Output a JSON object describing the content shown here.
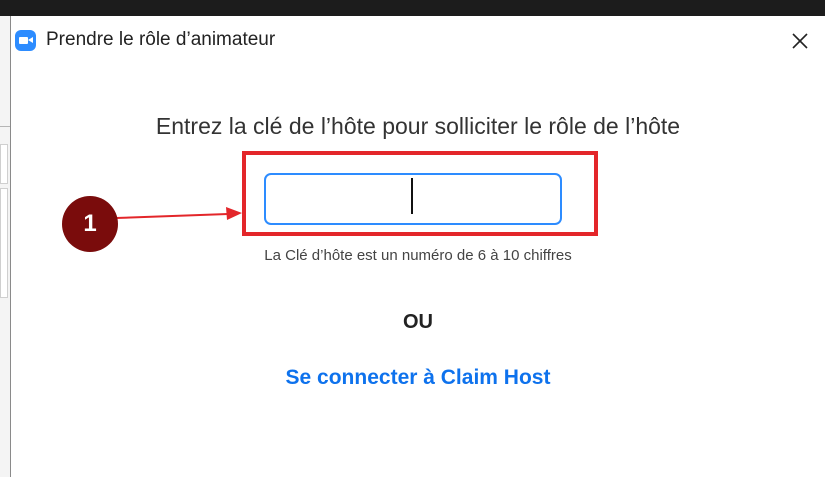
{
  "dialog": {
    "title": "Prendre le rôle d’animateur",
    "close_label": "✕"
  },
  "main": {
    "prompt": "Entrez la clé de l’hôte pour solliciter le rôle de l’hôte",
    "host_key_value": "",
    "hint": "La Clé d’hôte est un numéro de 6 à 10 chiffres",
    "or_label": "OU",
    "claim_link": "Se connecter à Claim Host"
  },
  "annotation": {
    "step_number": "1",
    "marker_color": "#7a0c0c",
    "highlight_color": "#e3262a"
  },
  "colors": {
    "accent": "#2d8cff",
    "link": "#0e72ed"
  },
  "icons": {
    "app": "zoom-camera-icon",
    "close": "close-icon"
  }
}
